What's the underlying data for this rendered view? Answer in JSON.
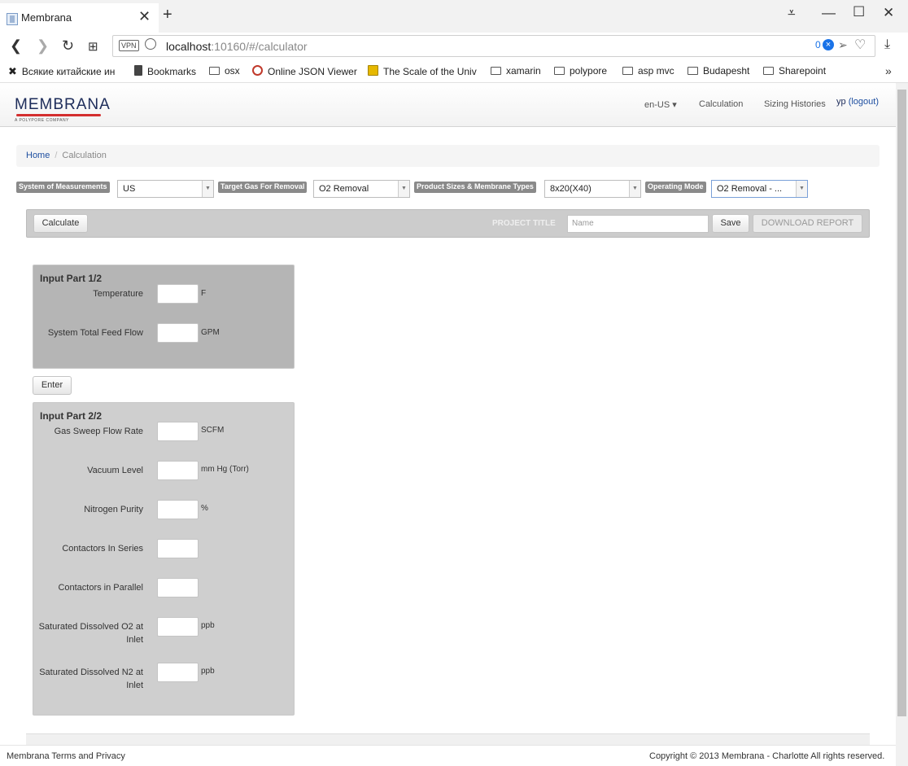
{
  "browser": {
    "tab_title": "Membrana",
    "tab_close": "✕",
    "new_tab": "+",
    "url_host": "localhost",
    "url_rest": ":10160/#/calculator",
    "vpn_label": "VPN",
    "adblock_count": "0",
    "bookmarks": [
      "Всякие китайские ин",
      "Bookmarks",
      "osx",
      "Online JSON Viewer",
      "The Scale of the Univ",
      "xamarin",
      "polypore",
      "asp mvc",
      "Budapesht",
      "Sharepoint"
    ],
    "more": "»"
  },
  "navbar": {
    "logo": "MEMBRANA",
    "logo_sub": "A POLYPORE COMPANY",
    "lang": "en-US ▾",
    "calculation": "Calculation",
    "sizing_histories": "Sizing Histories",
    "user": "yp",
    "logout": "(logout)"
  },
  "breadcrumb": {
    "home": "Home",
    "sep": "/",
    "current": "Calculation"
  },
  "filters": {
    "measurement_label": "System of Measurements",
    "measurement_value": "US",
    "target_gas_label": "Target Gas For Removal",
    "target_gas_value": "O2 Removal",
    "product_label": "Product Sizes & Membrane Types",
    "product_value": "8x20(X40)",
    "mode_label": "Operating Mode",
    "mode_value": "O2 Removal - ..."
  },
  "toolbar": {
    "calculate": "Calculate",
    "project_title": "PROJECT TITLE",
    "name_placeholder": "Name",
    "save": "Save",
    "download": "DOWNLOAD REPORT"
  },
  "part1": {
    "title": "Input Part 1/2",
    "temperature": "Temperature",
    "temperature_unit": "F",
    "feed_flow": "System Total Feed Flow",
    "feed_flow_unit": "GPM"
  },
  "enter_button": "Enter",
  "part2": {
    "title": "Input Part 2/2",
    "sweep": "Gas Sweep Flow Rate",
    "sweep_unit": "SCFM",
    "vacuum": "Vacuum Level",
    "vacuum_unit": "mm Hg (Torr)",
    "purity": "Nitrogen Purity",
    "purity_unit": "%",
    "series": "Contactors In Series",
    "parallel": "Contactors in Parallel",
    "o2": "Saturated Dissolved O2 at Inlet",
    "o2_unit": "ppb",
    "n2": "Saturated Dissolved N2 at Inlet",
    "n2_unit": "ppb"
  },
  "footer": {
    "terms": "Membrana Terms and Privacy",
    "copyright": "Copyright © 2013 Membrana - Charlotte All rights reserved."
  }
}
